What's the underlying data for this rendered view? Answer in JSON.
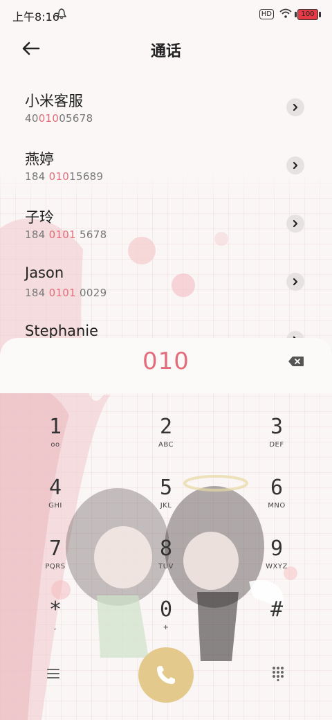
{
  "status": {
    "time": "上午8:16",
    "hd_label": "HD",
    "battery": "100"
  },
  "header": {
    "title": "通话"
  },
  "contacts": [
    {
      "name": "小米客服",
      "num_pre": "40",
      "num_hl": "010",
      "num_post": "05678"
    },
    {
      "name": "燕婷",
      "num_pre": "184 ",
      "num_hl": "010",
      "num_post": "15689"
    },
    {
      "name": "子玲",
      "num_pre": "184 ",
      "num_hl": "0101",
      "num_post": " 5678"
    },
    {
      "name": "Jason",
      "num_pre": "184 ",
      "num_hl": "0101",
      "num_post": " 0029"
    },
    {
      "name": "Stephanie",
      "num_pre": "",
      "num_hl": "",
      "num_post": ""
    }
  ],
  "dialer": {
    "input": "010",
    "keys": [
      {
        "digit": "1",
        "letters": "ᴏᴏ"
      },
      {
        "digit": "2",
        "letters": "ABC"
      },
      {
        "digit": "3",
        "letters": "DEF"
      },
      {
        "digit": "4",
        "letters": "GHI"
      },
      {
        "digit": "5",
        "letters": "JKL"
      },
      {
        "digit": "6",
        "letters": "MNO"
      },
      {
        "digit": "7",
        "letters": "PQRS"
      },
      {
        "digit": "8",
        "letters": "TUV"
      },
      {
        "digit": "9",
        "letters": "WXYZ"
      },
      {
        "digit": "*",
        "letters": ","
      },
      {
        "digit": "0",
        "letters": "+"
      },
      {
        "digit": "#",
        "letters": ""
      }
    ]
  },
  "colors": {
    "accent": "#e26d7a",
    "call_button": "#e3c98b"
  },
  "icons": {
    "back": "arrow-left-icon",
    "chevron": "chevron-right-icon",
    "backspace": "backspace-icon",
    "call": "phone-icon",
    "menu": "menu-icon",
    "keypad": "keypad-icon"
  }
}
